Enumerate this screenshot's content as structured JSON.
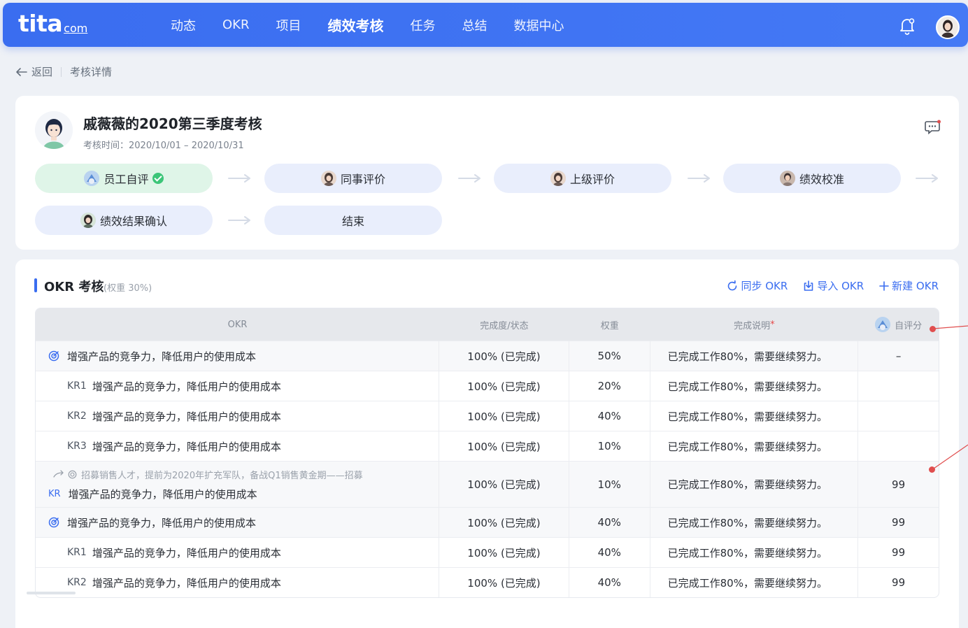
{
  "nav": {
    "logo_main": "tita",
    "logo_sub": "com",
    "items": [
      "动态",
      "OKR",
      "项目",
      "绩效考核",
      "任务",
      "总结",
      "数据中心"
    ],
    "active_index": 3
  },
  "breadcrumb": {
    "back": "返回",
    "current": "考核详情"
  },
  "review": {
    "title": "戚薇薇的2020第三季度考核",
    "period": "考核时间：2020/10/01 – 2020/10/31",
    "steps": [
      "员工自评",
      "同事评价",
      "上级评价",
      "绩效校准",
      "绩效结果确认",
      "结束"
    ]
  },
  "okr_section": {
    "title": "OKR 考核",
    "weight": "(权重 30%)",
    "actions": {
      "sync": "同步 OKR",
      "import": "导入 OKR",
      "create": "新建 OKR"
    },
    "columns": {
      "okr": "OKR",
      "progress": "完成度/状态",
      "weight": "权重",
      "note": "完成说明",
      "note_required": "*",
      "self_score": "自评分"
    },
    "rows": [
      {
        "type": "O",
        "text": "增强产品的竞争力，降低用户的使用成本",
        "progress": "100% (已完成)",
        "weight": "50%",
        "note": "已完成工作80%，需要继续努力。",
        "score": "–"
      },
      {
        "type": "KR",
        "tag": "KR1",
        "text": "增强产品的竞争力，降低用户的使用成本",
        "progress": "100% (已完成)",
        "weight": "20%",
        "note": "已完成工作80%，需要继续努力。",
        "score": ""
      },
      {
        "type": "KR",
        "tag": "KR2",
        "text": "增强产品的竞争力，降低用户的使用成本",
        "progress": "100% (已完成)",
        "weight": "40%",
        "note": "已完成工作80%，需要继续努力。",
        "score": ""
      },
      {
        "type": "KR",
        "tag": "KR3",
        "text": "增强产品的竞争力，降低用户的使用成本",
        "progress": "100% (已完成)",
        "weight": "10%",
        "note": "已完成工作80%，需要继续努力。",
        "score": ""
      },
      {
        "type": "LINKED",
        "parent": "招募销售人才，提前为2020年扩充军队，备战Q1销售黄金期——招募",
        "tag": "KR",
        "text": "增强产品的竞争力，降低用户的使用成本",
        "progress": "100% (已完成)",
        "weight": "10%",
        "note": "已完成工作80%，需要继续努力。",
        "score": "99"
      },
      {
        "type": "O",
        "text": "增强产品的竞争力，降低用户的使用成本",
        "progress": "100% (已完成)",
        "weight": "40%",
        "note": "已完成工作80%，需要继续努力。",
        "score": "99"
      },
      {
        "type": "KR",
        "tag": "KR1",
        "text": "增强产品的竞争力，降低用户的使用成本",
        "progress": "100% (已完成)",
        "weight": "40%",
        "note": "已完成工作80%，需要继续努力。",
        "score": "99"
      },
      {
        "type": "KR",
        "tag": "KR2",
        "text": "增强产品的竞争力，降低用户的使用成本",
        "progress": "100% (已完成)",
        "weight": "40%",
        "note": "已完成工作80%，需要继续努力。",
        "score": "99"
      }
    ]
  },
  "colors": {
    "primary": "#3a6df0",
    "done_step": "#dff5e8",
    "pending_step": "#e9eefc",
    "check": "#3cc578",
    "annotation": "#e04e4e"
  }
}
